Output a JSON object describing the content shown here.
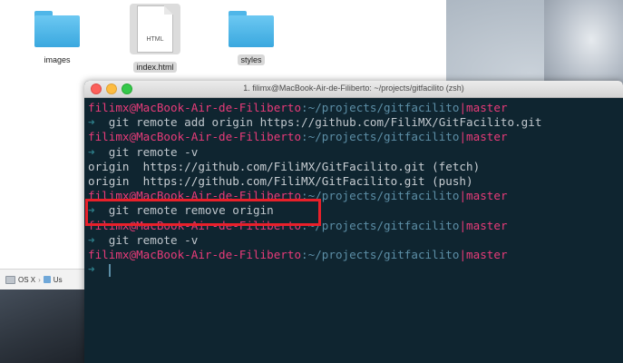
{
  "finder": {
    "items": [
      {
        "label": "images",
        "type": "folder"
      },
      {
        "label": "index.html",
        "type": "document",
        "doc_text": "HTML"
      },
      {
        "label": "styles",
        "type": "folder"
      }
    ],
    "pathbar": {
      "drive": "OS X",
      "next": "Us"
    }
  },
  "terminal": {
    "title": "1. filimx@MacBook-Air-de-Filiberto: ~/projects/gitfacilito (zsh)",
    "prompt": {
      "user": "filimx@MacBook-Air-de-Filiberto",
      "path": ":~/projects/gitfacilito",
      "sep": "|",
      "branch": "master",
      "arrow": "➜"
    },
    "lines": [
      {
        "kind": "prompt"
      },
      {
        "kind": "cmd",
        "text": "  git remote add origin https://github.com/FiliMX/GitFacilito.git"
      },
      {
        "kind": "prompt"
      },
      {
        "kind": "cmd",
        "text": "  git remote -v"
      },
      {
        "kind": "out",
        "text": "origin  https://github.com/FiliMX/GitFacilito.git (fetch)"
      },
      {
        "kind": "out",
        "text": "origin  https://github.com/FiliMX/GitFacilito.git (push)"
      },
      {
        "kind": "prompt"
      },
      {
        "kind": "cmd",
        "text": "  git remote remove origin"
      },
      {
        "kind": "prompt"
      },
      {
        "kind": "cmd",
        "text": "  git remote -v"
      },
      {
        "kind": "prompt"
      },
      {
        "kind": "cursor"
      }
    ]
  },
  "colors": {
    "terminal_bg": "#0f2530",
    "user": "#e83b79",
    "path": "#5c8ea6",
    "highlight": "#e8202a"
  }
}
